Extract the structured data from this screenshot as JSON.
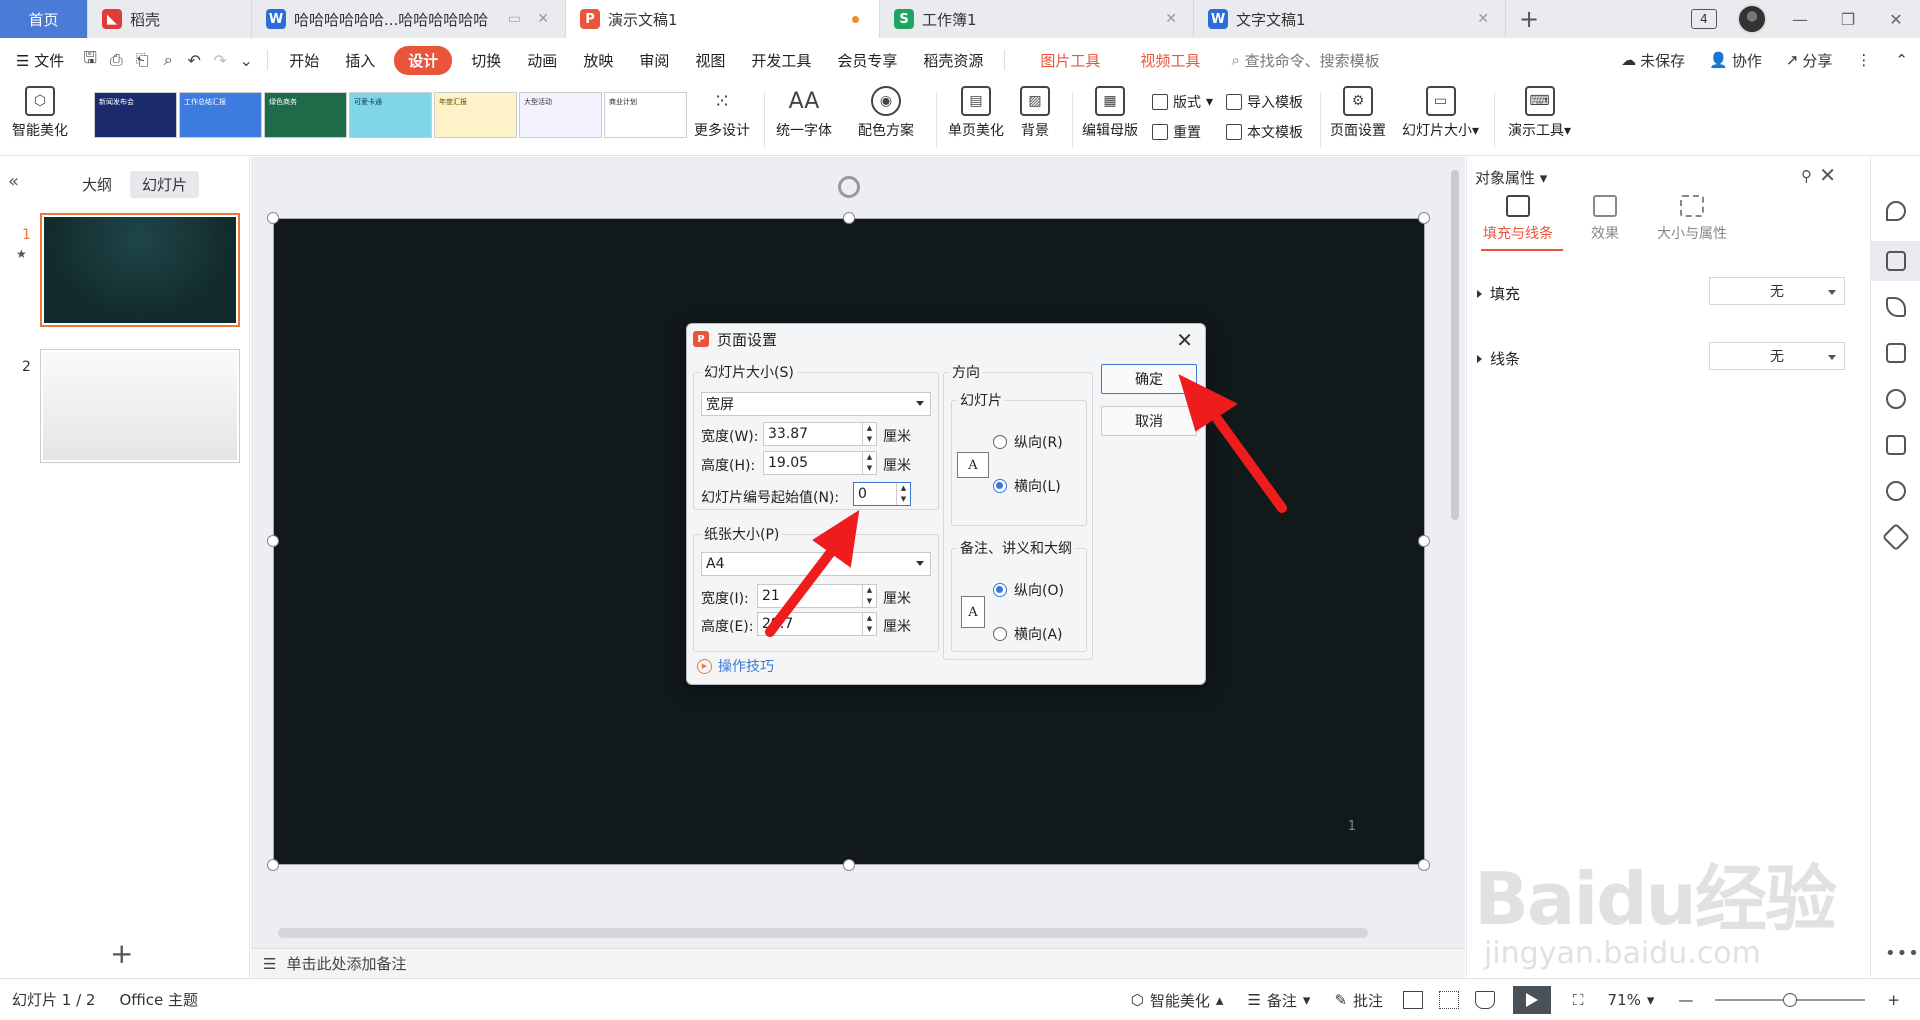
{
  "tabs": [
    {
      "label": "首页",
      "type": "home"
    },
    {
      "label": "稻壳",
      "icon": "daoke-icon",
      "color": "#e03b3b"
    },
    {
      "label": "哈哈哈哈哈哈...哈哈哈哈哈哈",
      "icon": "writer-icon",
      "color": "#2d6bd6",
      "glyph": "W"
    },
    {
      "label": "演示文稿1",
      "icon": "presentation-icon",
      "color": "#e8553a",
      "glyph": "P",
      "active": true
    },
    {
      "label": "工作簿1",
      "icon": "spreadsheet-icon",
      "color": "#1fa463",
      "glyph": "S"
    },
    {
      "label": "文字文稿1",
      "icon": "writer-icon",
      "color": "#2d6bd6",
      "glyph": "W"
    }
  ],
  "window": {
    "badge": "4"
  },
  "menu": {
    "file": "文件",
    "items": [
      "开始",
      "插入",
      "设计",
      "切换",
      "动画",
      "放映",
      "审阅",
      "视图",
      "开发工具",
      "会员专享",
      "稻壳资源"
    ],
    "active": "设计",
    "contextual": [
      "图片工具",
      "视频工具"
    ],
    "search": "查找命令、搜索模板",
    "unsaved": "未保存",
    "collab": "协作",
    "share": "分享"
  },
  "ribbon": {
    "smart_beautify": "智能美化",
    "more_design": "更多设计",
    "unify_font": "统一字体",
    "color_scheme": "配色方案",
    "single_page": "单页美化",
    "background": "背景",
    "edit_master": "编辑母版",
    "layout": "版式",
    "reset": "重置",
    "import_template": "导入模板",
    "this_template": "本文模板",
    "page_setup": "页面设置",
    "slide_size": "幻灯片大小",
    "present_tools": "演示工具",
    "thumb_texts": [
      "新闻发布会",
      "工作总结汇报",
      "绿色商务",
      "可爱卡通",
      "年度汇报",
      "大型活动",
      "商业计划"
    ]
  },
  "left_pane": {
    "tab_outline": "大纲",
    "tab_slides": "幻灯片",
    "slides": [
      {
        "num": "1"
      },
      {
        "num": "2"
      }
    ]
  },
  "slide": {
    "page_number": "1"
  },
  "notes": {
    "placeholder": "单击此处添加备注"
  },
  "dialog": {
    "title": "页面设置",
    "slide_size_label": "幻灯片大小(S)",
    "slide_size_value": "宽屏",
    "width_label": "宽度(W):",
    "width_value": "33.87",
    "height_label": "高度(H):",
    "height_value": "19.05",
    "unit": "厘米",
    "start_num_label": "幻灯片编号起始值(N):",
    "start_num_value": "0",
    "paper_label": "纸张大小(P)",
    "paper_value": "A4",
    "paper_width_label": "宽度(I):",
    "paper_width_value": "21",
    "paper_height_label": "高度(E):",
    "paper_height_value": "29.7",
    "orientation_label": "方向",
    "slides_group": "幻灯片",
    "portrait_r": "纵向(R)",
    "landscape_l": "横向(L)",
    "notes_group": "备注、讲义和大纲",
    "portrait_o": "纵向(O)",
    "landscape_a": "横向(A)",
    "ok": "确定",
    "cancel": "取消",
    "tips": "操作技巧",
    "orient_glyph": "A"
  },
  "right_panel": {
    "title": "对象属性",
    "tab_fill": "填充与线条",
    "tab_effect": "效果",
    "tab_size": "大小与属性",
    "fill_label": "填充",
    "fill_value": "无",
    "line_label": "线条",
    "line_value": "无"
  },
  "status": {
    "slide_info": "幻灯片 1 / 2",
    "theme": "Office 主题",
    "smart": "智能美化",
    "notes": "备注",
    "comments": "批注",
    "zoom": "71%"
  },
  "watermark": {
    "main": "Baidu经验",
    "sub": "jingyan.baidu.com"
  },
  "colors": {
    "accent": "#e8553a",
    "home_tab": "#4a7bd6",
    "slide_bg": "#11191b",
    "arrow": "#ee1c1c",
    "focus": "#3a78d8"
  }
}
